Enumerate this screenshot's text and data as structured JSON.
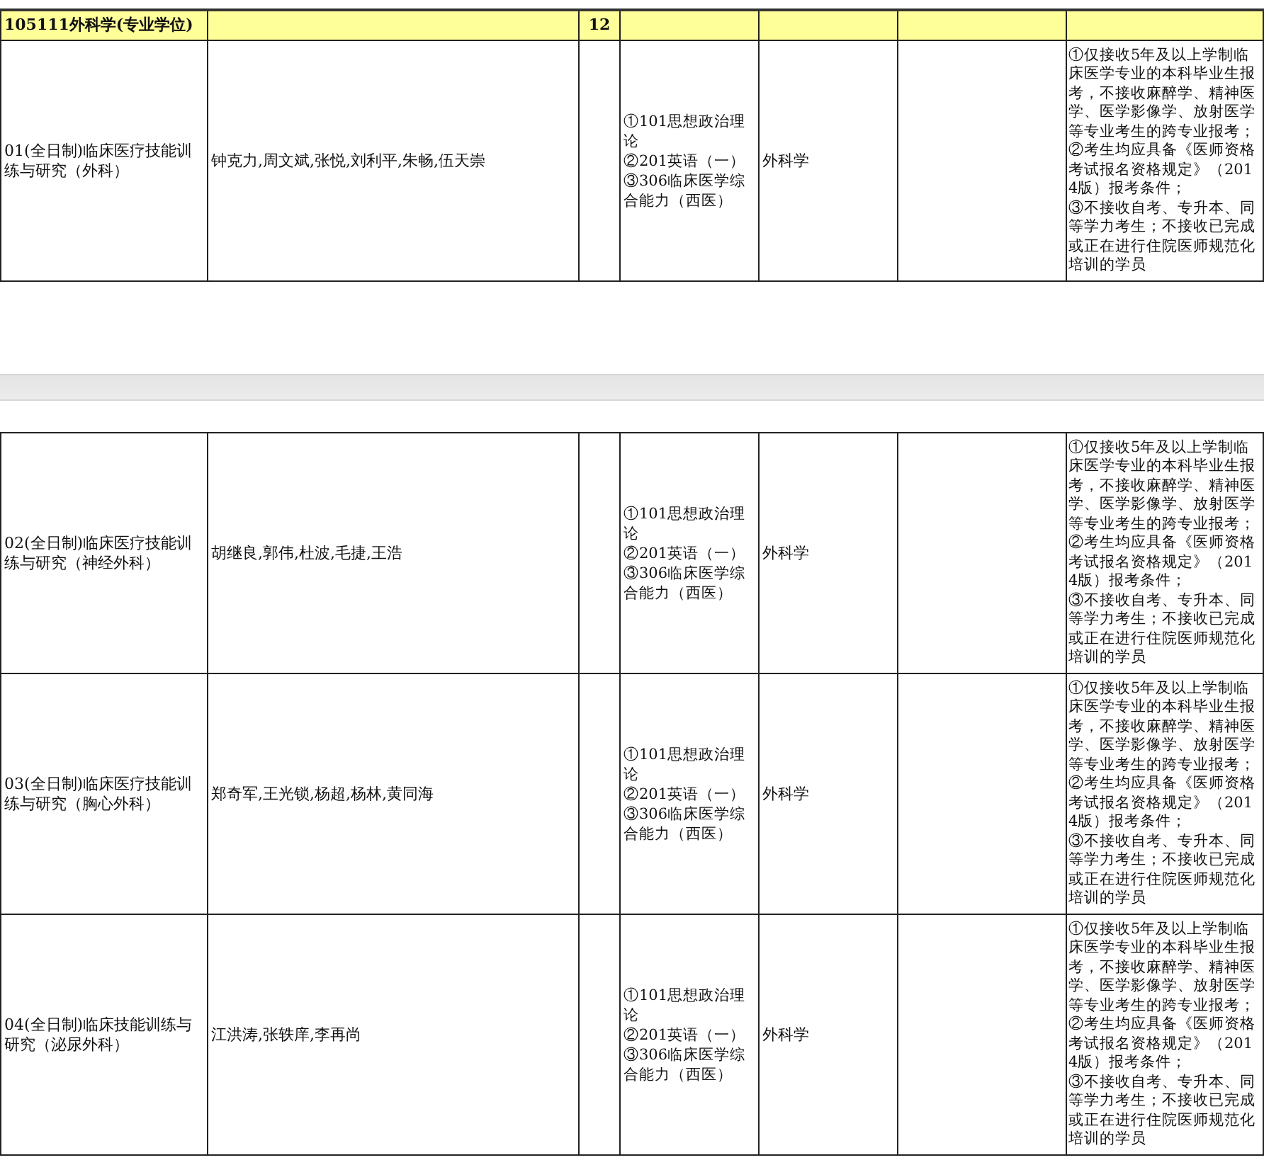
{
  "sections": [
    {
      "header": {
        "name": "105111外科学(专业学位)",
        "count": "12"
      },
      "rows": [
        {
          "direction": "01(全日制)临床医疗技能训练与研究（外科）",
          "teachers": "钟克力,周文斌,张悦,刘利平,朱畅,伍天崇",
          "exams": [
            "①101思想政治理论",
            "②201英语（一）",
            "③306临床医学综合能力（西医）"
          ],
          "subject": "外科学",
          "notes": [
            "①仅接收5年及以上学制临床医学专业的本科毕业生报考，不接收麻醉学、精神医学、医学影像学、放射医学等专业考生的跨专业报考；",
            "②考生均应具备《医师资格考试报名资格规定》（2014版）报考条件；",
            "③不接收自考、专升本、同等学力考生；不接收已完成或正在进行住院医师规范化培训的学员"
          ]
        }
      ]
    },
    {
      "rows": [
        {
          "direction": "02(全日制)临床医疗技能训练与研究（神经外科）",
          "teachers": "胡继良,郭伟,杜波,毛捷,王浩",
          "exams": [
            "①101思想政治理论",
            "②201英语（一）",
            "③306临床医学综合能力（西医）"
          ],
          "subject": "外科学",
          "notes": [
            "①仅接收5年及以上学制临床医学专业的本科毕业生报考，不接收麻醉学、精神医学、医学影像学、放射医学等专业考生的跨专业报考；",
            "②考生均应具备《医师资格考试报名资格规定》（2014版）报考条件；",
            "③不接收自考、专升本、同等学力考生；不接收已完成或正在进行住院医师规范化培训的学员"
          ]
        },
        {
          "direction": "03(全日制)临床医疗技能训练与研究（胸心外科）",
          "teachers": "郑奇军,王光锁,杨超,杨林,黄同海",
          "exams": [
            "①101思想政治理论",
            "②201英语（一）",
            "③306临床医学综合能力（西医）"
          ],
          "subject": "外科学",
          "notes": [
            "①仅接收5年及以上学制临床医学专业的本科毕业生报考，不接收麻醉学、精神医学、医学影像学、放射医学等专业考生的跨专业报考；",
            "②考生均应具备《医师资格考试报名资格规定》（2014版）报考条件；",
            "③不接收自考、专升本、同等学力考生；不接收已完成或正在进行住院医师规范化培训的学员"
          ]
        },
        {
          "direction": "04(全日制)临床技能训练与研究（泌尿外科）",
          "teachers": "江洪涛,张轶庠,李再尚",
          "exams": [
            "①101思想政治理论",
            "②201英语（一）",
            "③306临床医学综合能力（西医）"
          ],
          "subject": "外科学",
          "notes": [
            "①仅接收5年及以上学制临床医学专业的本科毕业生报考，不接收麻醉学、精神医学、医学影像学、放射医学等专业考生的跨专业报考；",
            "②考生均应具备《医师资格考试报名资格规定》（2014版）报考条件；",
            "③不接收自考、专升本、同等学力考生；不接收已完成或正在进行住院医师规范化培训的学员"
          ]
        }
      ]
    }
  ]
}
